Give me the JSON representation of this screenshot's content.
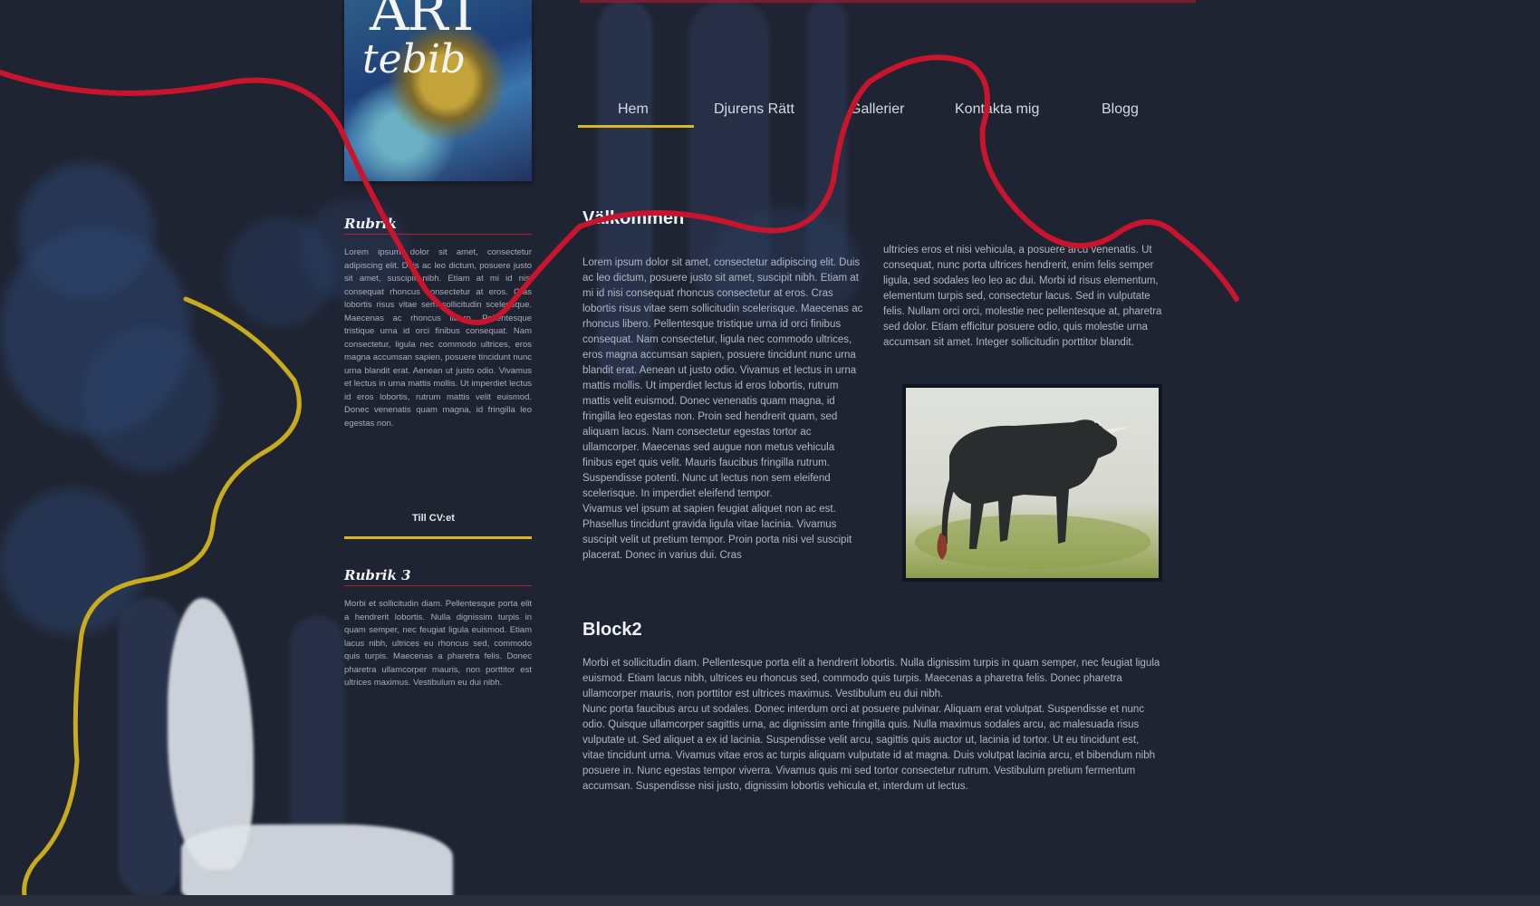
{
  "logo": {
    "line1": "ART",
    "line2": "tebib"
  },
  "nav": {
    "items": [
      "Hem",
      "Djurens Rätt",
      "Gallerier",
      "Kontakta mig",
      "Blogg"
    ],
    "active": "Hem"
  },
  "sidebar": {
    "rubrik1": {
      "heading": "Rubrik",
      "text": "Lorem ipsum dolor sit amet, consectetur adipiscing elit. Duis ac leo dictum, posuere justo sit amet, suscipit nibh. Etiam at mi id nisi consequat rhoncus consectetur at eros. Cras lobortis risus vitae sem sollicitudin scelerisque. Maecenas ac rhoncus libero. Pellentesque tristique urna id orci finibus consequat. Nam consectetur, ligula nec commodo ultrices, eros magna accumsan sapien, posuere tincidunt nunc urna blandit erat. Aenean ut justo odio. Vivamus et lectus in urna mattis mollis. Ut imperdiet lectus id eros lobortis, rutrum mattis velit euismod. Donec venenatis quam magna, id fringilla leo egestas non."
    },
    "cv_link": "Till CV:et",
    "rubrik3": {
      "heading": "Rubrik 3",
      "text": "Morbi et sollicitudin diam. Pellentesque porta elit a hendrerit lobortis. Nulla dignissim turpis in quam semper, nec feugiat ligula euismod. Etiam lacus nibh, ultrices eu rhoncus sed, commodo quis turpis. Maecenas a pharetra felis. Donec pharetra ullamcorper mauris, non porttitor est ultrices maximus. Vestibulum eu dui nibh."
    }
  },
  "main": {
    "welcome_heading": "Välkommen",
    "welcome_col1": "Lorem ipsum dolor sit amet, consectetur adipiscing elit. Duis ac leo dictum, posuere justo sit amet, suscipit nibh. Etiam at mi id nisi consequat rhoncus consectetur at eros. Cras lobortis risus vitae sem sollicitudin scelerisque. Maecenas ac rhoncus libero. Pellentesque tristique urna id orci finibus consequat. Nam consectetur, ligula nec commodo ultrices, eros magna accumsan sapien, posuere tincidunt nunc urna blandit erat. Aenean ut justo odio. Vivamus et lectus in urna mattis mollis. Ut imperdiet lectus id eros lobortis, rutrum mattis velit euismod. Donec venenatis quam magna, id fringilla leo egestas non. Proin sed hendrerit quam, sed aliquam lacus. Nam consectetur egestas tortor ac ullamcorper. Maecenas sed augue non metus vehicula finibus eget quis velit. Mauris faucibus fringilla rutrum. Suspendisse potenti. Nunc ut lectus non sem eleifend scelerisque. In imperdiet eleifend tempor.",
    "welcome_col1_b": "Vivamus vel ipsum at sapien feugiat aliquet non ac est. Phasellus tincidunt gravida ligula vitae lacinia. Vivamus suscipit velit ut pretium tempor. Proin porta nisi vel suscipit placerat. Donec in varius dui. Cras",
    "welcome_col2": "ultricies eros et nisi vehicula, a posuere arcu venenatis. Ut consequat, nunc porta ultrices hendrerit, enim felis semper ligula, sed sodales leo leo ac dui. Morbi id risus elementum, elementum turpis sed, consectetur lacus. Sed in vulputate felis. Nullam orci orci, molestie nec pellentesque at, pharetra sed dolor. Etiam efficitur posuere odio, quis molestie urna accumsan sit amet. Integer sollicitudin porttitor blandit.",
    "block2_heading": "Block2",
    "block2_p1": "Morbi et sollicitudin diam. Pellentesque porta elit a hendrerit lobortis. Nulla dignissim turpis in quam semper, nec feugiat ligula euismod. Etiam lacus nibh, ultrices eu rhoncus sed, commodo quis turpis. Maecenas a pharetra felis. Donec pharetra ullamcorper mauris, non porttitor est ultrices maximus. Vestibulum eu dui nibh.",
    "block2_p2": "Nunc porta faucibus arcu ut sodales. Donec interdum orci at posuere pulvinar. Aliquam erat volutpat. Suspendisse et nunc odio. Quisque ullamcorper sagittis urna, ac dignissim ante fringilla quis. Nulla maximus sodales arcu, ac malesuada risus vulputate ut. Sed aliquet a ex id lacinia. Suspendisse velit arcu, sagittis quis auctor ut, lacinia id tortor. Ut eu tincidunt est, vitae tincidunt urna. Vivamus vitae eros ac turpis aliquam vulputate id at magna. Duis volutpat lacinia arcu, et bibendum nibh posuere in. Nunc egestas tempor viverra. Vivamus quis mi sed tortor consectetur rutrum. Vestibulum pretium fermentum accumsan. Suspendisse nisi justo, dignissim lobortis vehicula et, interdum ut lectus."
  }
}
